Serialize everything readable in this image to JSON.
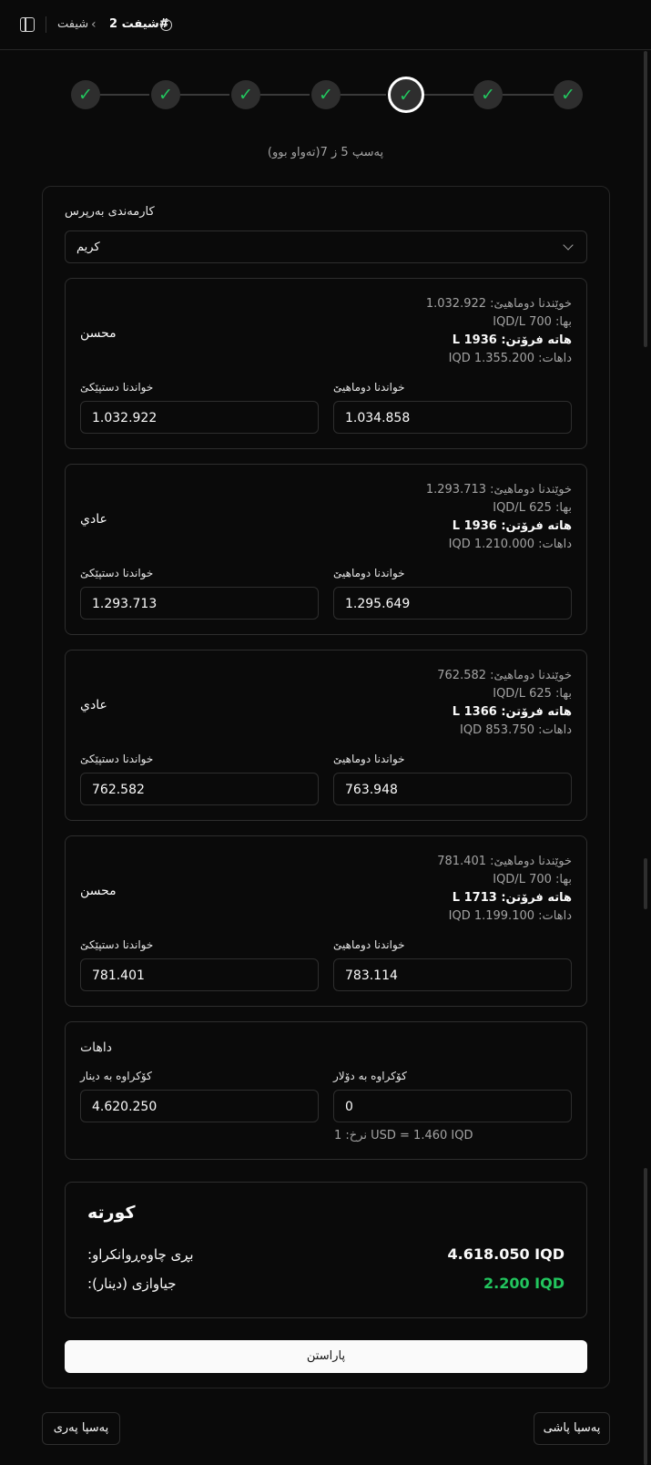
{
  "header": {
    "parent": "شیفت",
    "current": "شیفت 2#"
  },
  "stepper": {
    "total": 7,
    "current": 5,
    "caption": "پەسپ 5 ز 7(تەواو بوو)"
  },
  "employee": {
    "label": "کارمەندی بەرپرس",
    "selected": "كريم"
  },
  "pumps": [
    {
      "name": "محسن",
      "last_reading_label": "خوێندنا دوماهیێ:",
      "last_reading": "1.032.922",
      "price_label": "بها:",
      "price": "700",
      "price_unit": "IQD/L",
      "sold_label": "هاتە فرۆتن:",
      "sold": "1936",
      "sold_unit": "L",
      "income_label": "داهات:",
      "income": "1.355.200",
      "income_unit": "IQD",
      "start_label": "خواندنا دستپێکێ",
      "start_value": "1.032.922",
      "end_label": "خواندنا دوماهیێ",
      "end_value": "1.034.858"
    },
    {
      "name": "عادي",
      "last_reading_label": "خوێندنا دوماهیێ:",
      "last_reading": "1.293.713",
      "price_label": "بها:",
      "price": "625",
      "price_unit": "IQD/L",
      "sold_label": "هاتە فرۆتن:",
      "sold": "1936",
      "sold_unit": "L",
      "income_label": "داهات:",
      "income": "1.210.000",
      "income_unit": "IQD",
      "start_label": "خواندنا دستپێکێ",
      "start_value": "1.293.713",
      "end_label": "خواندنا دوماهیێ",
      "end_value": "1.295.649"
    },
    {
      "name": "عادي",
      "last_reading_label": "خوێندنا دوماهیێ:",
      "last_reading": "762.582",
      "price_label": "بها:",
      "price": "625",
      "price_unit": "IQD/L",
      "sold_label": "هاتە فرۆتن:",
      "sold": "1366",
      "sold_unit": "L",
      "income_label": "داهات:",
      "income": "853.750",
      "income_unit": "IQD",
      "start_label": "خواندنا دستپێکێ",
      "start_value": "762.582",
      "end_label": "خواندنا دوماهیێ",
      "end_value": "763.948"
    },
    {
      "name": "محسن",
      "last_reading_label": "خوێندنا دوماهیێ:",
      "last_reading": "781.401",
      "price_label": "بها:",
      "price": "700",
      "price_unit": "IQD/L",
      "sold_label": "هاتە فرۆتن:",
      "sold": "1713",
      "sold_unit": "L",
      "income_label": "داهات:",
      "income": "1.199.100",
      "income_unit": "IQD",
      "start_label": "خواندنا دستپێکێ",
      "start_value": "781.401",
      "end_label": "خواندنا دوماهیێ",
      "end_value": "783.114"
    }
  ],
  "income_box": {
    "title": "داهات",
    "dinar_label": "کۆکراوە بە دینار",
    "dinar_value": "4.620.250",
    "dollar_label": "کۆکراوە بە دۆلار",
    "dollar_value": "0",
    "rate_note": "1 :نرخ USD = 1.460 IQD"
  },
  "summary": {
    "title": "کورتە",
    "expected_label": ":بڕی چاوەڕوانکراو",
    "expected_value": "4.618.050 IQD",
    "diff_label": ":جیاوازی (دینار)",
    "diff_value": "2.200 IQD",
    "diff_color": "#22c55e"
  },
  "actions": {
    "save": "پاراستن",
    "prev": "پەسپا پەری",
    "next": "پەسپا پاشی"
  }
}
